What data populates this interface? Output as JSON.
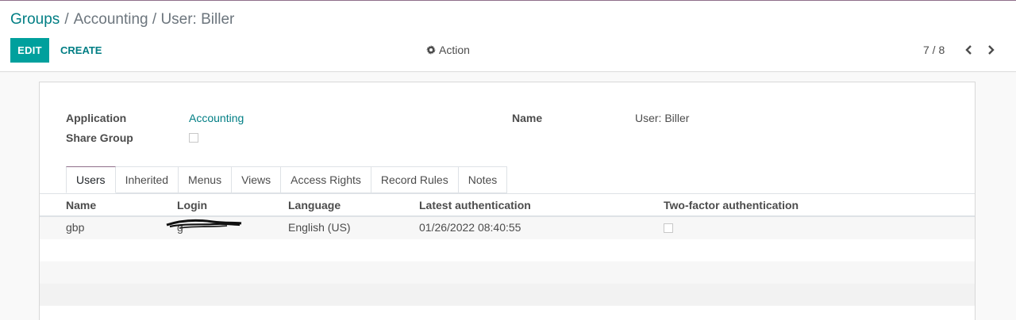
{
  "breadcrumb": {
    "root": "Groups",
    "separator": "/",
    "current": "Accounting / User: Biller"
  },
  "toolbar": {
    "edit_label": "EDIT",
    "create_label": "CREATE",
    "action_label": "Action",
    "pager_value": "7 / 8"
  },
  "icons": {
    "action": "gear-icon",
    "prev": "chevron-left-icon",
    "next": "chevron-right-icon"
  },
  "form": {
    "application_label": "Application",
    "application_value": "Accounting",
    "share_group_label": "Share Group",
    "share_group_checked": false,
    "name_label": "Name",
    "name_value": "User: Biller"
  },
  "tabs": [
    "Users",
    "Inherited",
    "Menus",
    "Views",
    "Access Rights",
    "Record Rules",
    "Notes"
  ],
  "active_tab": "Users",
  "users_table": {
    "columns": [
      "Name",
      "Login",
      "Language",
      "Latest authentication",
      "Two-factor authentication"
    ],
    "rows": [
      {
        "name": "gbp",
        "login": "g",
        "language": "English (US)",
        "latest_authentication": "01/26/2022 08:40:55",
        "two_factor": false
      }
    ]
  },
  "colors": {
    "accent": "#00a09d",
    "link": "#017e84",
    "tab_active_border": "#8f6f8a"
  }
}
